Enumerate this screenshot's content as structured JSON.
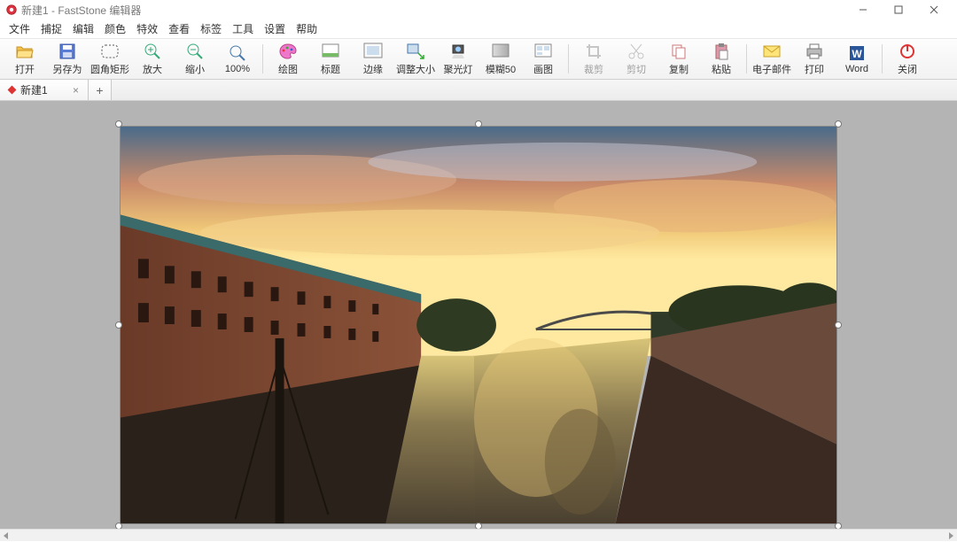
{
  "titlebar": {
    "title": "新建1 - FastStone 编辑器"
  },
  "menu": [
    "文件",
    "捕捉",
    "编辑",
    "颜色",
    "特效",
    "查看",
    "标签",
    "工具",
    "设置",
    "帮助"
  ],
  "toolbar": {
    "open": "打开",
    "saveas": "另存为",
    "roundrect": "圆角矩形",
    "zoomin": "放大",
    "zoomout": "缩小",
    "zoom100": "100%",
    "draw": "绘图",
    "caption": "标题",
    "edge": "边缘",
    "resize": "调整大小",
    "spotlight": "聚光灯",
    "blur": "模糊50",
    "thumb": "画图",
    "crop": "裁剪",
    "cut": "剪切",
    "copy": "复制",
    "paste": "粘贴",
    "email": "电子邮件",
    "print": "打印",
    "word": "Word",
    "close": "关闭"
  },
  "tabs": {
    "active": "新建1"
  },
  "image": {
    "alt": "Sunset cityscape with river, historic brick buildings on left bank, bridge, and trees on right bank"
  }
}
